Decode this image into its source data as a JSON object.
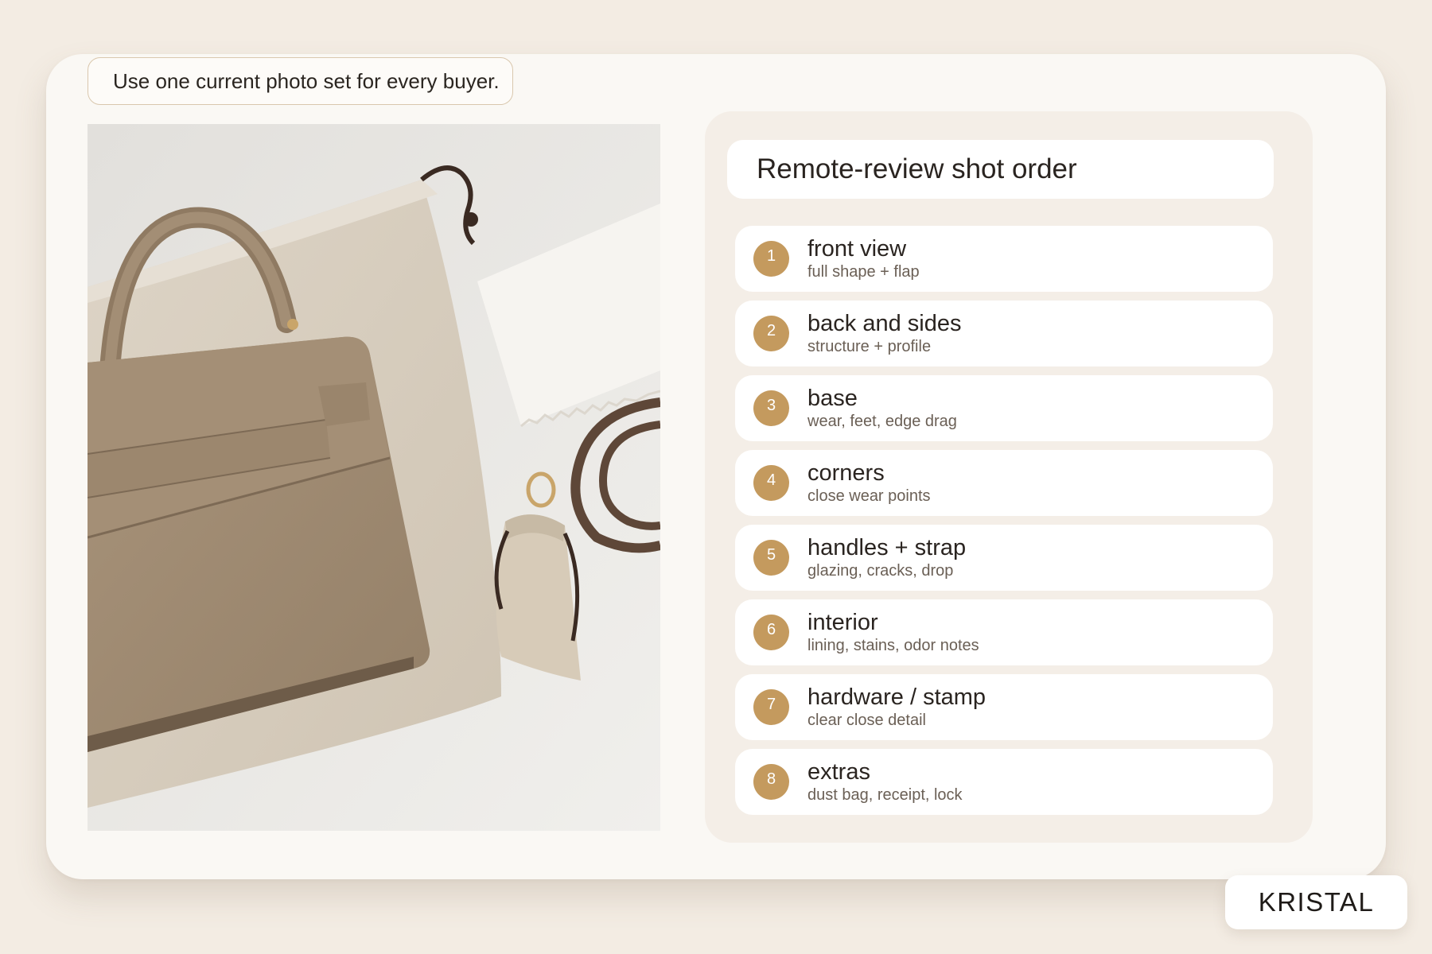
{
  "tip": {
    "text": "Use one current photo set for every buyer."
  },
  "photo": {
    "subject": "taupe-leather-top-handle-bag-with-dust-bag-strap-and-cloth"
  },
  "panel": {
    "title": "Remote-review shot order",
    "steps": [
      {
        "num": "1",
        "title": "front view",
        "sub": "full shape + flap"
      },
      {
        "num": "2",
        "title": "back and sides",
        "sub": "structure + profile"
      },
      {
        "num": "3",
        "title": "base",
        "sub": "wear, feet, edge drag"
      },
      {
        "num": "4",
        "title": "corners",
        "sub": "close wear points"
      },
      {
        "num": "5",
        "title": "handles + strap",
        "sub": "glazing, cracks, drop"
      },
      {
        "num": "6",
        "title": "interior",
        "sub": "lining, stains, odor notes"
      },
      {
        "num": "7",
        "title": "hardware / stamp",
        "sub": "clear close detail"
      },
      {
        "num": "8",
        "title": "extras",
        "sub": "dust bag, receipt, lock"
      }
    ]
  },
  "brand": {
    "name": "KRISTAL"
  },
  "colors": {
    "background": "#f3ece3",
    "card": "#faf8f4",
    "panel": "#f4eee7",
    "accent": "#c49a5e",
    "leather": "#a08c74"
  }
}
